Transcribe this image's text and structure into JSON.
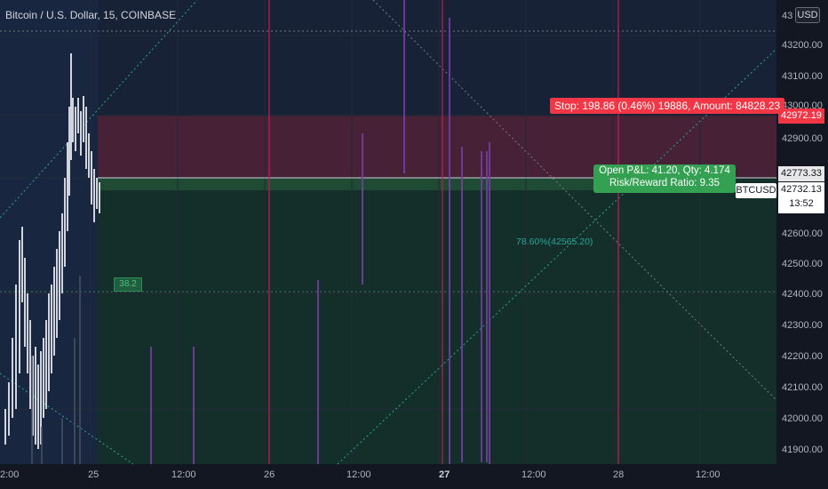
{
  "chart_title": "Bitcoin / U.S. Dollar, 15, COINBASE",
  "currency_button": "USD",
  "colors": {
    "background": "#131722",
    "stop_zone": "#f23645",
    "target_zone": "#26a69a",
    "pnl_box": "#33a052",
    "vertical_lines": "#c2185b"
  },
  "price_axis": {
    "top_label": "43",
    "labels": [
      "43200.00",
      "43100.00",
      "43000.00",
      "42900.00",
      "42600.00",
      "42500.00",
      "42400.00",
      "42300.00",
      "42200.00",
      "42100.00",
      "42000.00",
      "41900.00"
    ]
  },
  "time_axis": {
    "labels": [
      {
        "text": "2:00",
        "bold": false
      },
      {
        "text": "25",
        "bold": false
      },
      {
        "text": "12:00",
        "bold": false
      },
      {
        "text": "26",
        "bold": false
      },
      {
        "text": "12:00",
        "bold": false
      },
      {
        "text": "27",
        "bold": true
      },
      {
        "text": "12:00",
        "bold": false
      },
      {
        "text": "28",
        "bold": false
      },
      {
        "text": "12:00",
        "bold": false
      }
    ]
  },
  "position_tool": {
    "stop_text": "Stop: 198.86 (0.46%) 19886, Amount: 84828.23",
    "stop_price": "42972.19",
    "entry_price": "42773.33",
    "pnl_line1": "Open P&L: 41.20, Qty: 4.174",
    "pnl_line2": "Risk/Reward Ratio: 9.35",
    "target_pct_box": "38.2"
  },
  "last_price": {
    "ticker": "BTCUSD",
    "price": "42732.13",
    "countdown": "13:52"
  },
  "fib_label": "78.60%(42565.20)"
}
